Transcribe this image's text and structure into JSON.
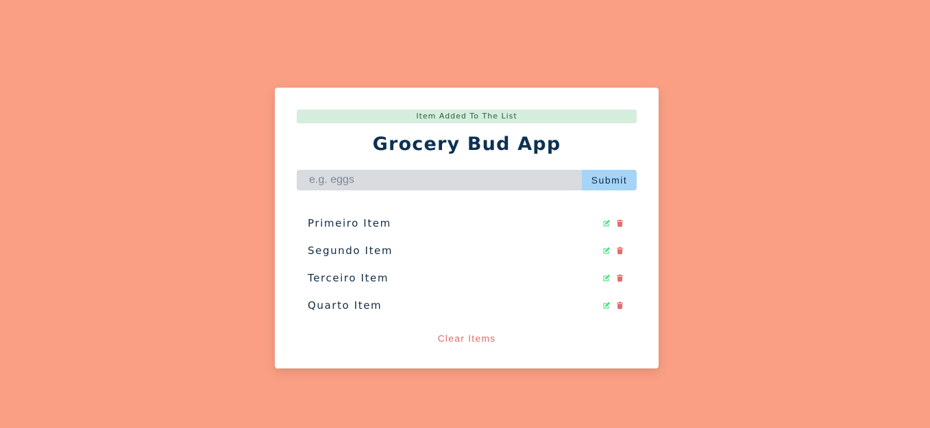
{
  "alert": {
    "text": "Item Added To The List",
    "color": "#d4eddd"
  },
  "header": {
    "title": "Grocery Bud App"
  },
  "form": {
    "placeholder": "e.g. eggs",
    "value": "",
    "submit_label": "Submit"
  },
  "list": {
    "items": [
      {
        "label": "Primeiro Item",
        "edit_icon": "edit-icon",
        "delete_icon": "trash-icon"
      },
      {
        "label": "Segundo Item",
        "edit_icon": "edit-icon",
        "delete_icon": "trash-icon"
      },
      {
        "label": "Terceiro Item",
        "edit_icon": "edit-icon",
        "delete_icon": "trash-icon"
      },
      {
        "label": "Quarto Item",
        "edit_icon": "edit-icon",
        "delete_icon": "trash-icon"
      }
    ]
  },
  "footer": {
    "clear_label": "Clear Items"
  },
  "colors": {
    "background": "#fa9f84",
    "card": "#ffffff",
    "title": "#0d3152",
    "submit_bg": "#a5d4f7",
    "edit_icon": "#4ade80",
    "delete_icon": "#e66b6b",
    "clear_text": "#e66b6b"
  }
}
